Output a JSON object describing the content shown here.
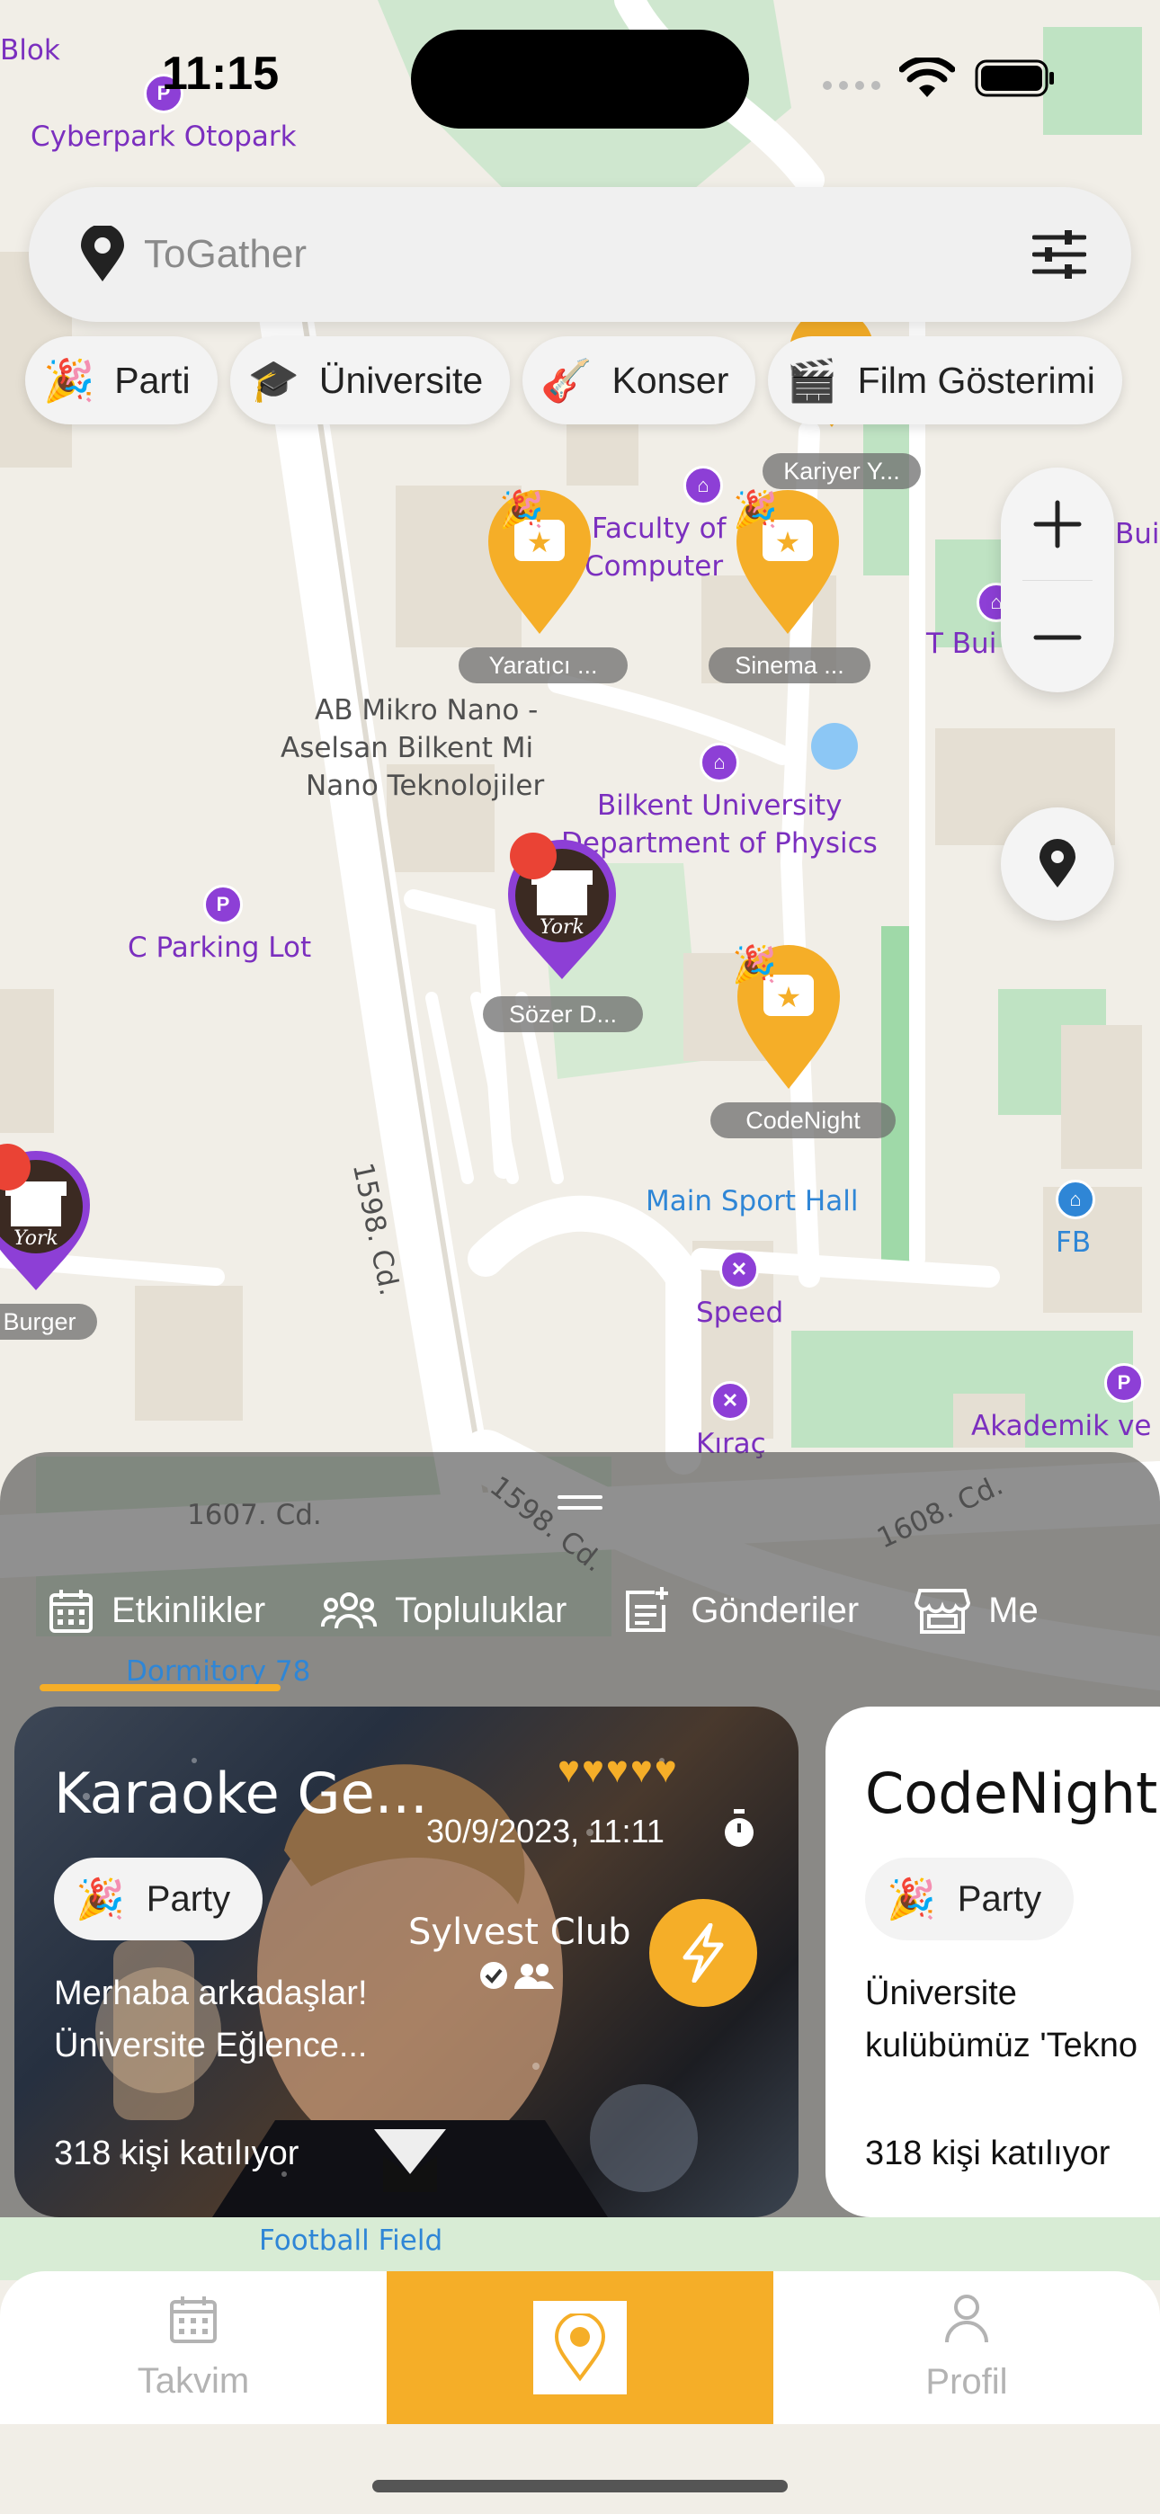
{
  "status_bar": {
    "time": "11:15"
  },
  "search": {
    "placeholder": "ToGather"
  },
  "chips": [
    {
      "icon": "party-popper-icon",
      "glyph": "🎉",
      "label": "Parti"
    },
    {
      "icon": "graduation-cap-icon",
      "glyph": "🎓",
      "label": "Üniversite"
    },
    {
      "icon": "guitar-icon",
      "glyph": "🎸",
      "label": "Konser"
    },
    {
      "icon": "clapperboard-icon",
      "glyph": "🎬",
      "label": "Film Gösterimi"
    }
  ],
  "map": {
    "labels": {
      "blok": "Blok",
      "cyberpark": "Cyberpark Otopark",
      "faculty": "Faculty of",
      "computer": "Computer",
      "t_building": "T Bui",
      "bui": "Bui",
      "ab_mikro_1": "AB Mikro Nano -",
      "ab_mikro_2": "Aselsan Bilkent Mi",
      "ab_mikro_3": "Nano Teknolojiler",
      "bilkent_1": "Bilkent University",
      "bilkent_2": "Department of Physics",
      "c_parking": "C Parking Lot",
      "street_1598": "1598. Cd.",
      "street_1598b": "1598. Cd.",
      "main_sport": "Main Sport Hall",
      "fb": "FB",
      "speed": "Speed",
      "kirac": "Kıraç",
      "akademik": "Akademik ve",
      "burger": "Burger",
      "street_1607": "1607. Cd.",
      "street_1608": "1608. Cd.",
      "dormitory": "Dormitory 78",
      "football": "Football Field"
    },
    "markers": {
      "kariyer": "Kariyer Y...",
      "yaratici": "Yaratıcı ...",
      "sinema": "Sinema ...",
      "sozer": "Sözer D...",
      "codenight": "CodeNight"
    }
  },
  "sheet": {
    "tabs": [
      {
        "icon": "calendar-icon",
        "label": "Etkinlikler"
      },
      {
        "icon": "people-icon",
        "label": "Topluluklar"
      },
      {
        "icon": "post-add-icon",
        "label": "Gönderiler"
      },
      {
        "icon": "store-icon",
        "label": "Me"
      }
    ],
    "cards": [
      {
        "title": "Karaoke Ge...",
        "date": "30/9/2023, 11:11",
        "rating": 5,
        "category": "Party",
        "club": "Sylvest Club",
        "description_1": "Merhaba arkadaşlar!",
        "description_2": "Üniversite Eğlence...",
        "attendees": "318 kişi katılıyor"
      },
      {
        "title": "CodeNight",
        "category": "Party",
        "description_1": "Üniversite",
        "description_2": "kulübümüz 'Tekno",
        "attendees": "318 kişi katılıyor"
      }
    ]
  },
  "bottom_nav": [
    {
      "icon": "calendar-icon",
      "label": "Takvim"
    },
    {
      "icon": "map-pin-icon",
      "label": ""
    },
    {
      "icon": "person-icon",
      "label": "Profil"
    }
  ],
  "colors": {
    "accent": "#f5ae28",
    "marker_purple": "#8d3fd6",
    "pin_red": "#ea4335"
  }
}
